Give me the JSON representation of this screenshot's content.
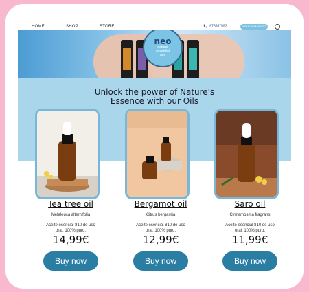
{
  "nav": {
    "items": [
      "HOME",
      "SHOP",
      "STORE"
    ],
    "phone": "673937592",
    "cta": "ASESORAMIENTO"
  },
  "hero": {
    "logo_main": "neo",
    "logo_sub": [
      "natural",
      "essential",
      "oils"
    ],
    "bottle_labels": [
      "Frankincense",
      "Lavender",
      "Bergamot",
      "Balance"
    ]
  },
  "section": {
    "title_lines": [
      "Unlock the power of Nature's",
      "Essence with our Oils"
    ]
  },
  "products": [
    {
      "name": "Tea tree oil",
      "latin": "Melaleuca alternifolia",
      "desc_lines": [
        "Aceite esencial 810 de uso",
        "oral, 100% puro."
      ],
      "price": "14,99€",
      "buy": "Buy now"
    },
    {
      "name": "Bergamot oil",
      "latin": "Citrus bergamia",
      "desc_lines": [
        "Aceite esencial 810 de uso",
        "oral, 100% puro."
      ],
      "price": "12,99€",
      "buy": "Buy now"
    },
    {
      "name": "Saro oil",
      "latin": "Cinnamosma fragrans",
      "desc_lines": [
        "Aceite esencial 810 de uso",
        "oral, 100% puro."
      ],
      "price": "11,99€",
      "buy": "Buy now"
    }
  ],
  "colors": {
    "outer": "#f8b9cf",
    "band": "#a9d6ea",
    "button": "#2a7ea3",
    "card_border": "#79b7d8"
  }
}
